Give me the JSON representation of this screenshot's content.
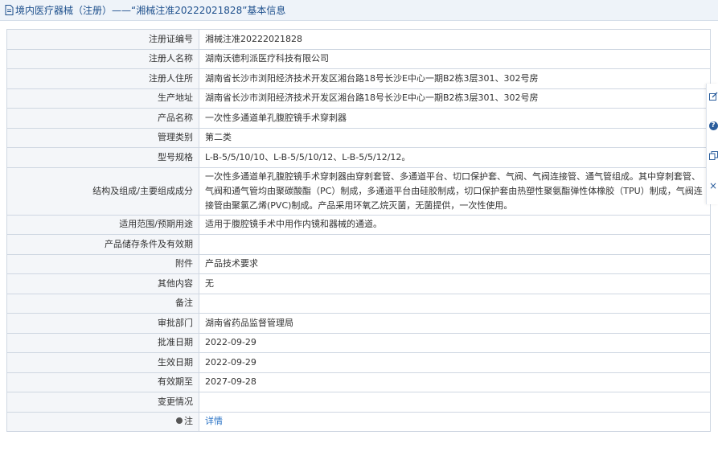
{
  "header": {
    "title": "境内医疗器械（注册）——“湘械注准20222021828”基本信息",
    "icon": "document-icon"
  },
  "rows": [
    {
      "label": "注册证编号",
      "value": "湘械注准20222021828"
    },
    {
      "label": "注册人名称",
      "value": "湖南沃德利派医疗科技有限公司"
    },
    {
      "label": "注册人住所",
      "value": "湖南省长沙市浏阳经济技术开发区湘台路18号长沙E中心一期B2栋3层301、302号房"
    },
    {
      "label": "生产地址",
      "value": "湖南省长沙市浏阳经济技术开发区湘台路18号长沙E中心一期B2栋3层301、302号房"
    },
    {
      "label": "产品名称",
      "value": "一次性多通道单孔腹腔镜手术穿刺器"
    },
    {
      "label": "管理类别",
      "value": "第二类"
    },
    {
      "label": "型号规格",
      "value": "L-B-5/5/10/10、L-B-5/5/10/12、L-B-5/5/12/12。"
    },
    {
      "label": "结构及组成/主要组成成分",
      "value": "一次性多通道单孔腹腔镜手术穿刺器由穿刺套管、多通道平台、切口保护套、气阀、气阀连接管、通气管组成。其中穿刺套管、气阀和通气管均由聚碳酸酯（PC）制成，多通道平台由硅胶制成，切口保护套由热塑性聚氨酯弹性体橡胶（TPU）制成，气阀连接管由聚氯乙烯(PVC)制成。产品采用环氧乙烷灭菌，无菌提供，一次性使用。"
    },
    {
      "label": "适用范围/预期用途",
      "value": "适用于腹腔镜手术中用作内镜和器械的通道。"
    },
    {
      "label": "产品储存条件及有效期",
      "value": ""
    },
    {
      "label": "附件",
      "value": "产品技术要求"
    },
    {
      "label": "其他内容",
      "value": "无"
    },
    {
      "label": "备注",
      "value": ""
    },
    {
      "label": "审批部门",
      "value": "湖南省药品监督管理局"
    },
    {
      "label": "批准日期",
      "value": "2022-09-29"
    },
    {
      "label": "生效日期",
      "value": "2022-09-29"
    },
    {
      "label": "有效期至",
      "value": "2027-09-28"
    },
    {
      "label": "变更情况",
      "value": ""
    }
  ],
  "note_row": {
    "label": "注",
    "link_text": "详情"
  },
  "side_tools": {
    "edit": "edit-icon",
    "help": "?",
    "copy": "copy-icon",
    "close": "×"
  }
}
